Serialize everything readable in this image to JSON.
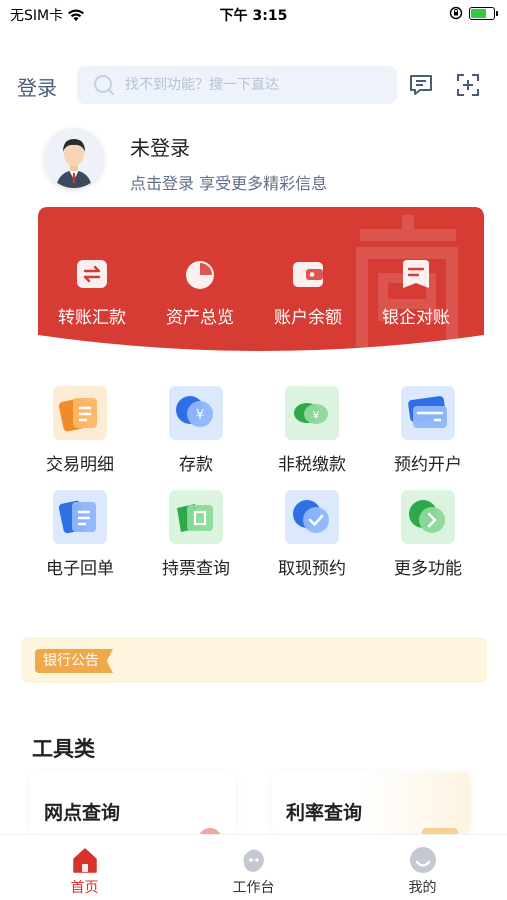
{
  "status_bar": {
    "carrier": "无SIM卡",
    "time": "下午 3:15"
  },
  "header": {
    "login_label": "登录",
    "search_placeholder": "找不到功能？搜一下直达",
    "icons": [
      "message-icon",
      "scan-icon"
    ]
  },
  "profile": {
    "name": "未登录",
    "tip": "点击登录 享受更多精彩信息"
  },
  "banner": {
    "color": "#d63b34",
    "items": [
      {
        "label": "转账汇款",
        "icon": "transfer-icon"
      },
      {
        "label": "资产总览",
        "icon": "pie-chart-icon"
      },
      {
        "label": "账户余额",
        "icon": "wallet-icon"
      },
      {
        "label": "银企对账",
        "icon": "reconcile-icon"
      }
    ]
  },
  "grid": {
    "items": [
      {
        "label": "交易明细",
        "icon": "transaction-detail-icon",
        "color": "#f5a142"
      },
      {
        "label": "存款",
        "icon": "deposit-icon",
        "color": "#3d7ef0"
      },
      {
        "label": "非税缴款",
        "icon": "non-tax-payment-icon",
        "color": "#43b95a"
      },
      {
        "label": "预约开户",
        "icon": "account-opening-icon",
        "color": "#3d7ef0"
      },
      {
        "label": "电子回单",
        "icon": "e-receipt-icon",
        "color": "#3d7ef0"
      },
      {
        "label": "持票查询",
        "icon": "bill-query-icon",
        "color": "#43b95a"
      },
      {
        "label": "取现预约",
        "icon": "withdrawal-booking-icon",
        "color": "#3d7ef0"
      },
      {
        "label": "更多功能",
        "icon": "more-functions-icon",
        "color": "#43b95a"
      }
    ]
  },
  "notice": {
    "tag": "银行公告"
  },
  "tools": {
    "title": "工具类",
    "cards": [
      {
        "label": "网点查询"
      },
      {
        "label": "利率查询"
      }
    ]
  },
  "tabbar": {
    "active_color": "#d9312b",
    "tabs": [
      {
        "label": "首页",
        "icon": "home-icon",
        "active": true
      },
      {
        "label": "工作台",
        "icon": "workbench-icon",
        "active": false
      },
      {
        "label": "我的",
        "icon": "profile-icon",
        "active": false
      }
    ]
  }
}
